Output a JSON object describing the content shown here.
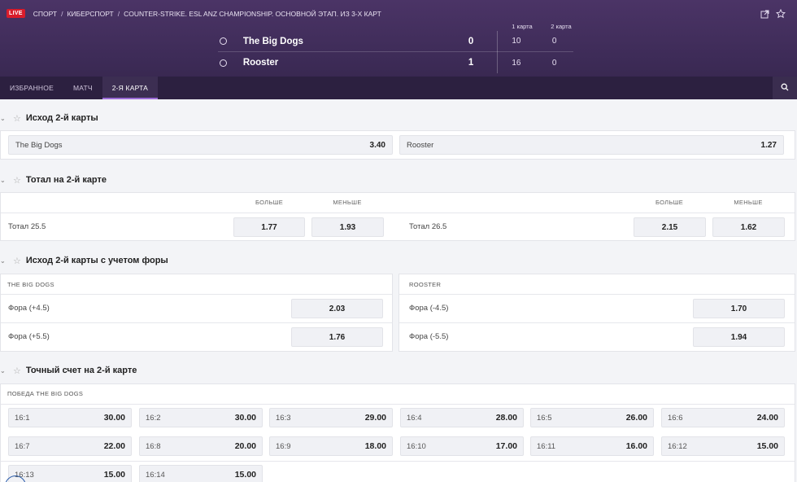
{
  "header": {
    "live_badge": "LIVE",
    "breadcrumbs": [
      "СПОРТ",
      "КИБЕРСПОРТ",
      "COUNTER-STRIKE. ESL ANZ CHAMPIONSHIP. ОСНОВНОЙ ЭТАП. ИЗ 3-Х КАРТ"
    ],
    "map_heads": [
      "1 карта",
      "2 карта"
    ],
    "teams": [
      {
        "name": "The Big Dogs",
        "total": "0",
        "maps": [
          "10",
          "0"
        ]
      },
      {
        "name": "Rooster",
        "total": "1",
        "maps": [
          "16",
          "0"
        ]
      }
    ]
  },
  "tabs": [
    {
      "label": "ИЗБРАННОЕ"
    },
    {
      "label": "МАТЧ"
    },
    {
      "label": "2-Я КАРТА"
    }
  ],
  "markets": {
    "outcome": {
      "title": "Исход 2-й карты",
      "odds": [
        {
          "label": "The Big Dogs",
          "value": "3.40"
        },
        {
          "label": "Rooster",
          "value": "1.27"
        }
      ]
    },
    "total": {
      "title": "Тотал на 2-й карте",
      "over": "БОЛЬШЕ",
      "under": "МЕНЬШЕ",
      "rows": [
        {
          "label": "Тотал 25.5",
          "over": "1.77",
          "under": "1.93"
        },
        {
          "label": "Тотал 26.5",
          "over": "2.15",
          "under": "1.62"
        }
      ]
    },
    "handicap": {
      "title": "Исход 2-й карты с учетом форы",
      "left": {
        "head": "THE BIG DOGS",
        "rows": [
          {
            "label": "Фора (+4.5)",
            "value": "2.03"
          },
          {
            "label": "Фора (+5.5)",
            "value": "1.76"
          }
        ]
      },
      "right": {
        "head": "ROOSTER",
        "rows": [
          {
            "label": "Фора (-4.5)",
            "value": "1.70"
          },
          {
            "label": "Фора (-5.5)",
            "value": "1.94"
          }
        ]
      }
    },
    "exact": {
      "title": "Точный счет на 2-й карте",
      "head": "ПОБЕДА THE BIG DOGS",
      "cells": [
        {
          "label": "16:1",
          "value": "30.00"
        },
        {
          "label": "16:2",
          "value": "30.00"
        },
        {
          "label": "16:3",
          "value": "29.00"
        },
        {
          "label": "16:4",
          "value": "28.00"
        },
        {
          "label": "16:5",
          "value": "26.00"
        },
        {
          "label": "16:6",
          "value": "24.00"
        },
        {
          "label": "16:7",
          "value": "22.00"
        },
        {
          "label": "16:8",
          "value": "20.00"
        },
        {
          "label": "16:9",
          "value": "18.00"
        },
        {
          "label": "16:10",
          "value": "17.00"
        },
        {
          "label": "16:11",
          "value": "16.00"
        },
        {
          "label": "16:12",
          "value": "15.00"
        },
        {
          "label": "16:13",
          "value": "15.00"
        },
        {
          "label": "16:14",
          "value": "15.00"
        }
      ]
    }
  }
}
